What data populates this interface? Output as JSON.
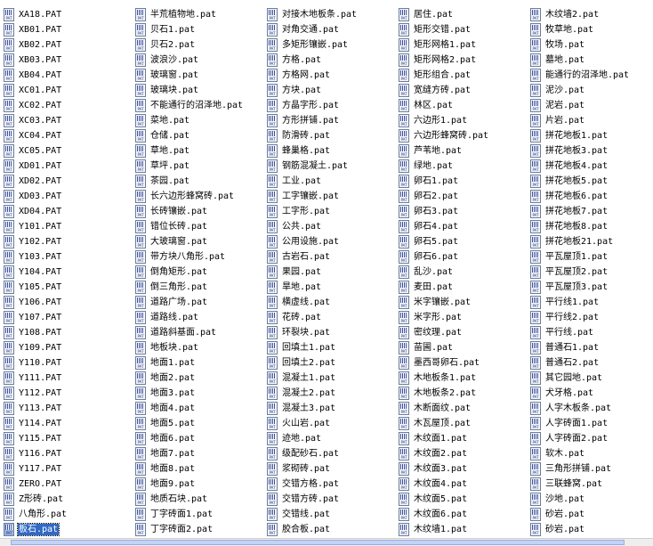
{
  "columns": [
    [
      "XA18.PAT",
      "XB01.PAT",
      "XB02.PAT",
      "XB03.PAT",
      "XB04.PAT",
      "XC01.PAT",
      "XC02.PAT",
      "XC03.PAT",
      "XC04.PAT",
      "XC05.PAT",
      "XD01.PAT",
      "XD02.PAT",
      "XD03.PAT",
      "XD04.PAT",
      "Y101.PAT",
      "Y102.PAT",
      "Y103.PAT",
      "Y104.PAT",
      "Y105.PAT",
      "Y106.PAT",
      "Y107.PAT",
      "Y108.PAT",
      "Y109.PAT",
      "Y110.PAT",
      "Y111.PAT",
      "Y112.PAT",
      "Y113.PAT",
      "Y114.PAT",
      "Y115.PAT",
      "Y116.PAT",
      "Y117.PAT",
      "ZERO.PAT",
      "Z形砖.pat",
      "八角形.pat",
      "板石.pat"
    ],
    [
      "半荒植物地.pat",
      "贝石1.pat",
      "贝石2.pat",
      "波浪沙.pat",
      "玻璃窗.pat",
      "玻璃块.pat",
      "不能通行的沼泽地.pat",
      "菜地.pat",
      "仓储.pat",
      "草地.pat",
      "草坪.pat",
      "茶园.pat",
      "长六边形蜂窝砖.pat",
      "长砖镶嵌.pat",
      "错位长砖.pat",
      "大玻璃窗.pat",
      "带方块八角形.pat",
      "倒角矩形.pat",
      "倒三角形.pat",
      "道路广场.pat",
      "道路线.pat",
      "道路斜基面.pat",
      "地板块.pat",
      "地面1.pat",
      "地面2.pat",
      "地面3.pat",
      "地面4.pat",
      "地面5.pat",
      "地面6.pat",
      "地面7.pat",
      "地面8.pat",
      "地面9.pat",
      "地质石块.pat",
      "丁字砖面1.pat",
      "丁字砖面2.pat"
    ],
    [
      "对接木地板条.pat",
      "对角交通.pat",
      "多矩形镶嵌.pat",
      "方格.pat",
      "方格网.pat",
      "方块.pat",
      "方晶字形.pat",
      "方形拼铺.pat",
      "防滑砖.pat",
      "蜂巢格.pat",
      "钢筋混凝土.pat",
      "工业.pat",
      "工字镶嵌.pat",
      "工字形.pat",
      "公共.pat",
      "公用设施.pat",
      "古岩石.pat",
      "果园.pat",
      "旱地.pat",
      "横虚线.pat",
      "花砖.pat",
      "环裂块.pat",
      "回填土1.pat",
      "回填土2.pat",
      "混凝土1.pat",
      "混凝土2.pat",
      "混凝土3.pat",
      "火山岩.pat",
      "迹地.pat",
      "级配砂石.pat",
      "浆砌砖.pat",
      "交错方格.pat",
      "交错方砖.pat",
      "交错线.pat",
      "胶合板.pat"
    ],
    [
      "居住.pat",
      "矩形交错.pat",
      "矩形网格1.pat",
      "矩形网格2.pat",
      "矩形组合.pat",
      "宽缝方砖.pat",
      "林区.pat",
      "六边形1.pat",
      "六边形蜂窝砖.pat",
      "芦苇地.pat",
      "绿地.pat",
      "卵石1.pat",
      "卵石2.pat",
      "卵石3.pat",
      "卵石4.pat",
      "卵石5.pat",
      "卵石6.pat",
      "乱沙.pat",
      "麦田.pat",
      "米字镶嵌.pat",
      "米字形.pat",
      "密纹理.pat",
      "苗圃.pat",
      "墨西哥卵石.pat",
      "木地板条1.pat",
      "木地板条2.pat",
      "木断面纹.pat",
      "木瓦屋顶.pat",
      "木纹面1.pat",
      "木纹面2.pat",
      "木纹面3.pat",
      "木纹面4.pat",
      "木纹面5.pat",
      "木纹面6.pat",
      "木纹墙1.pat"
    ],
    [
      "木纹墙2.pat",
      "牧草地.pat",
      "牧场.pat",
      "墓地.pat",
      "能通行的沼泽地.pat",
      "泥沙.pat",
      "泥岩.pat",
      "片岩.pat",
      "拼花地板1.pat",
      "拼花地板3.pat",
      "拼花地板4.pat",
      "拼花地板5.pat",
      "拼花地板6.pat",
      "拼花地板7.pat",
      "拼花地板8.pat",
      "拼花地板21.pat",
      "平瓦屋顶1.pat",
      "平瓦屋顶2.pat",
      "平瓦屋顶3.pat",
      "平行线1.pat",
      "平行线2.pat",
      "平行线.pat",
      "普通石1.pat",
      "普通石2.pat",
      "其它园地.pat",
      "犬牙格.pat",
      "人字木板条.pat",
      "人字砖面1.pat",
      "人字砖面2.pat",
      "软木.pat",
      "三角形拼铺.pat",
      "三联蜂窝.pat",
      "沙地.pat",
      "砂岩.pat",
      "砂岩.pat"
    ]
  ],
  "selected": "板石.pat"
}
